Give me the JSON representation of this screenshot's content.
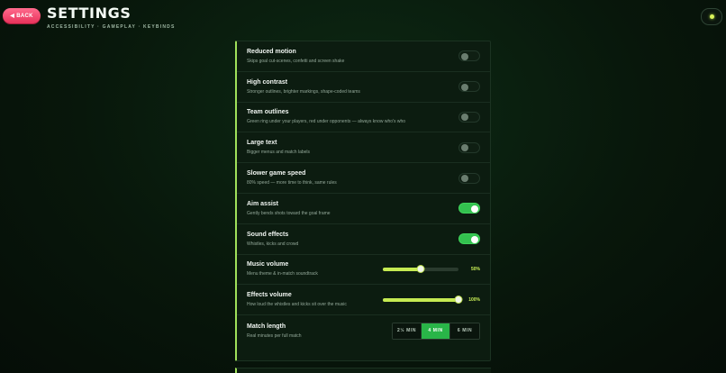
{
  "header": {
    "back_label": "BACK",
    "back_icon": "◀",
    "title": "SETTINGS",
    "subtitle": "ACCESSIBILITY · GAMEPLAY · KEYBINDS"
  },
  "colors": {
    "accent": "#c5ea52",
    "toggle_on": "#33c14f",
    "back_button": "#ff4d74"
  },
  "settings": [
    {
      "title": "Reduced motion",
      "desc": "Skips goal cut-scenes, confetti and screen shake",
      "type": "toggle",
      "on": false
    },
    {
      "title": "High contrast",
      "desc": "Stronger outlines, brighter markings, shape-coded teams",
      "type": "toggle",
      "on": false
    },
    {
      "title": "Team outlines",
      "desc": "Green ring under your players, red under opponents — always know who's who",
      "type": "toggle",
      "on": false
    },
    {
      "title": "Large text",
      "desc": "Bigger menus and match labels",
      "type": "toggle",
      "on": false
    },
    {
      "title": "Slower game speed",
      "desc": "80% speed — more time to think, same rules",
      "type": "toggle",
      "on": false
    },
    {
      "title": "Aim assist",
      "desc": "Gently bends shots toward the goal frame",
      "type": "toggle",
      "on": true
    },
    {
      "title": "Sound effects",
      "desc": "Whistles, kicks and crowd",
      "type": "toggle",
      "on": true
    },
    {
      "title": "Music volume",
      "desc": "Menu theme & in-match soundtrack",
      "type": "slider",
      "value": 50,
      "display": "50%"
    },
    {
      "title": "Effects volume",
      "desc": "How loud the whistles and kicks sit over the music",
      "type": "slider",
      "value": 100,
      "display": "100%"
    },
    {
      "title": "Match length",
      "desc": "Real minutes per full match",
      "type": "segmented",
      "options": [
        "2½ MIN",
        "4 MIN",
        "6 MIN"
      ],
      "selected": 1
    }
  ]
}
